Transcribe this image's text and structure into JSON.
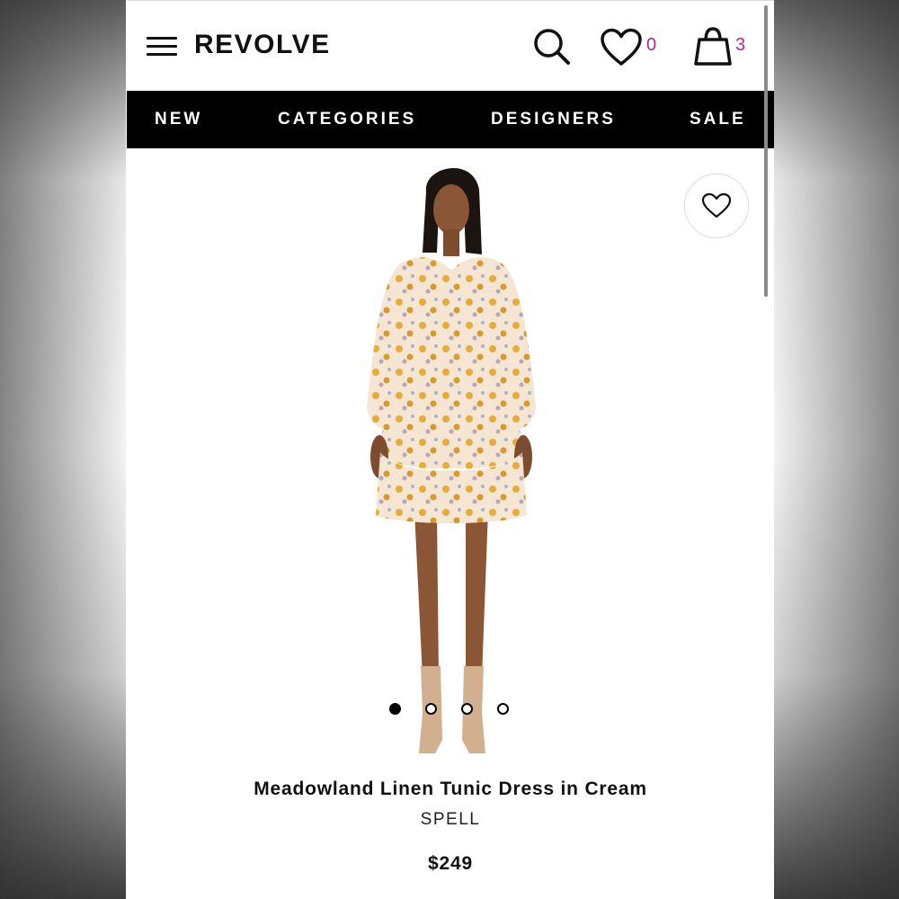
{
  "header": {
    "logo": "REVOLVE",
    "wishlist_count": "0",
    "bag_count": "3",
    "count_color": "#b0279c"
  },
  "nav": {
    "items": [
      "NEW",
      "CATEGORIES",
      "DESIGNERS",
      "SALE"
    ]
  },
  "gallery": {
    "slides_total": 4,
    "active_slide": 1
  },
  "product": {
    "name": "Meadowland Linen Tunic Dress in Cream",
    "brand": "SPELL",
    "price": "$249"
  },
  "icons": {
    "menu": "hamburger-menu-icon",
    "search": "search-icon",
    "wishlist": "heart-outline-icon",
    "bag": "shopping-bag-icon",
    "save": "heart-outline-icon"
  }
}
